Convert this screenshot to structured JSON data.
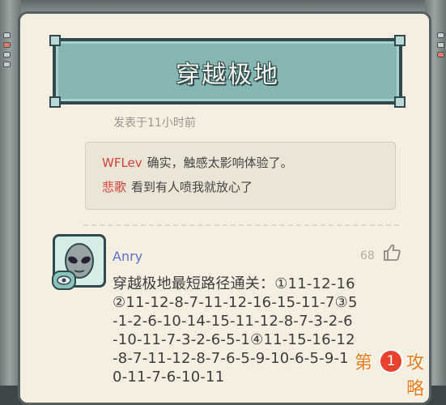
{
  "banner": {
    "title": "穿越极地"
  },
  "post": {
    "time": "发表于11小时前"
  },
  "replies": [
    {
      "name": "WFLev",
      "text": "确实，触感太影响体验了。"
    },
    {
      "name": "悲歌",
      "text": "看到有人喷我就放心了"
    }
  ],
  "comment": {
    "username": "Anry",
    "likes": "68",
    "lines": [
      "穿越极地最短路径通关：①11-12-16",
      "②11-12-8-7-11-12-16-15-11-7③5",
      "-1-2-6-10-14-15-11-12-8-7-3-2-6",
      "-10-11-7-3-2-6-5-1④11-15-16-12",
      "-8-7-11-12-8-7-6-5-9-10-6-5-9-1",
      "0-11-7-6-10-11"
    ]
  },
  "watermark": {
    "left": "第",
    "number": "1",
    "right": "攻略"
  },
  "colors": {
    "banner": "#86b6b2",
    "card": "#f5efe1",
    "reply_name": "#d8403b",
    "username": "#5a6fc9",
    "watermark": "#f07d1e"
  }
}
